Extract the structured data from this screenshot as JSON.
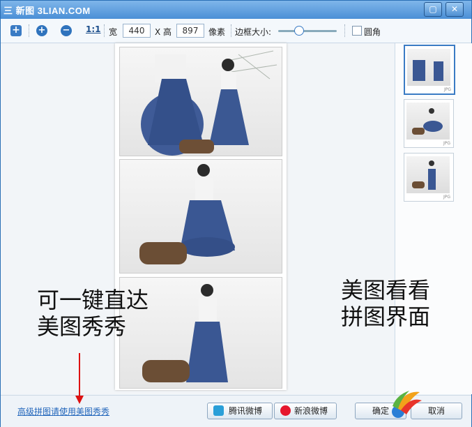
{
  "window": {
    "title": "三 新图 3LIAN.COM",
    "maximize_glyph": "▢",
    "close_glyph": "✕"
  },
  "toolbar": {
    "add_glyph": "+",
    "zoom_in_glyph": "+",
    "zoom_out_glyph": "−",
    "actual_size_label": "1:1",
    "width_label": "宽",
    "width_value": "440",
    "height_label": "X 高",
    "height_value": "897",
    "unit_label": "像素",
    "border_label": "边框大小:",
    "border_level": 0.35,
    "rounded_label": "圆角"
  },
  "thumbnails": [
    {
      "badge": "JPG",
      "selected": true
    },
    {
      "badge": "JPG",
      "selected": false
    },
    {
      "badge": "JPG",
      "selected": false
    }
  ],
  "annotations": {
    "left_line1": "可一键直达",
    "left_line2": "美图秀秀",
    "right_line1": "美图看看",
    "right_line2": "拼图界面"
  },
  "bottom": {
    "advanced_link": "高级拼图请使用美图秀秀",
    "tencent_button": "腾讯微博",
    "sina_button": "新浪微博",
    "ok_button": "确定",
    "cancel_button": "取消"
  },
  "colors": {
    "accent": "#3a7bc4",
    "arrow": "#dd1111",
    "link": "#2266bb"
  }
}
